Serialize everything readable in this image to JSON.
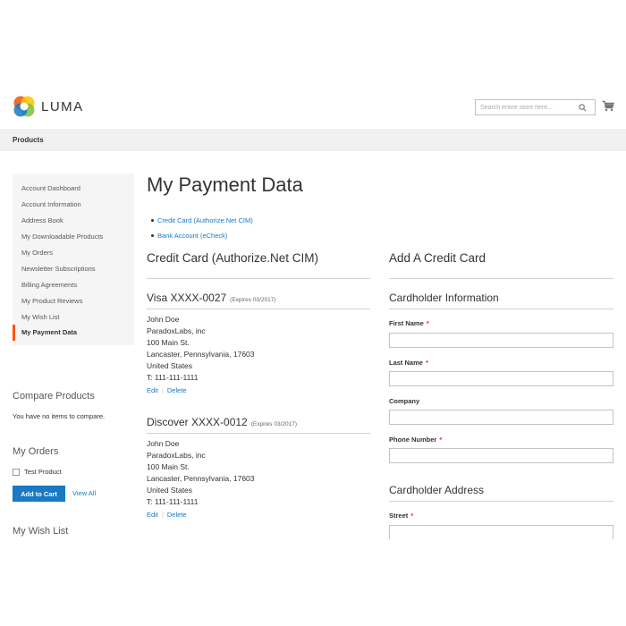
{
  "header": {
    "logo_text": "LUMA",
    "search_placeholder": "Search entire store here...",
    "colors": {
      "logo_orange": "#f26322",
      "logo_blue": "#1979c3",
      "logo_green": "#7bc142",
      "logo_yellow": "#ffc600"
    }
  },
  "nav": {
    "products": "Products"
  },
  "sidebar": {
    "items": [
      {
        "label": "Account Dashboard"
      },
      {
        "label": "Account Information"
      },
      {
        "label": "Address Book"
      },
      {
        "label": "My Downloadable Products"
      },
      {
        "label": "My Orders"
      },
      {
        "label": "Newsletter Subscriptions"
      },
      {
        "label": "Billing Agreements"
      },
      {
        "label": "My Product Reviews"
      },
      {
        "label": "My Wish List"
      },
      {
        "label": "My Payment Data"
      }
    ],
    "active_index": 9,
    "accent": "#ff5501",
    "compare_title": "Compare Products",
    "compare_text": "You have no items to compare.",
    "orders_title": "My Orders",
    "order_product": "Test Product",
    "add_to_cart": "Add to Cart",
    "view_all": "View All",
    "wishlist_title": "My Wish List"
  },
  "main": {
    "title": "My Payment Data",
    "anchors": [
      "Credit Card (Authorize.Net CIM)",
      "Bank Account (eCheck)"
    ],
    "left_section_title": "Credit Card (Authorize.Net CIM)",
    "cards": [
      {
        "name": "Visa XXXX-0027",
        "expires": "(Expires 03/2017)",
        "lines": [
          "John Doe",
          "ParadoxLabs, inc",
          "100 Main St.",
          "Lancaster, Pennsylvania, 17603",
          "United States",
          "T: 111-111-1111"
        ],
        "edit": "Edit",
        "delete": "Delete"
      },
      {
        "name": "Discover XXXX-0012",
        "expires": "(Expires 03/2017)",
        "lines": [
          "John Doe",
          "ParadoxLabs, inc",
          "100 Main St.",
          "Lancaster, Pennsylvania, 17603",
          "United States",
          "T: 111-111-1111"
        ],
        "edit": "Edit",
        "delete": "Delete"
      }
    ],
    "right_section_title": "Add A Credit Card",
    "cardholder_info_title": "Cardholder Information",
    "fields": {
      "first_name": "First Name",
      "last_name": "Last Name",
      "company": "Company",
      "phone": "Phone Number",
      "street": "Street"
    },
    "required_mark": "*",
    "cardholder_address_title": "Cardholder Address",
    "link_color": "#1979c3"
  }
}
